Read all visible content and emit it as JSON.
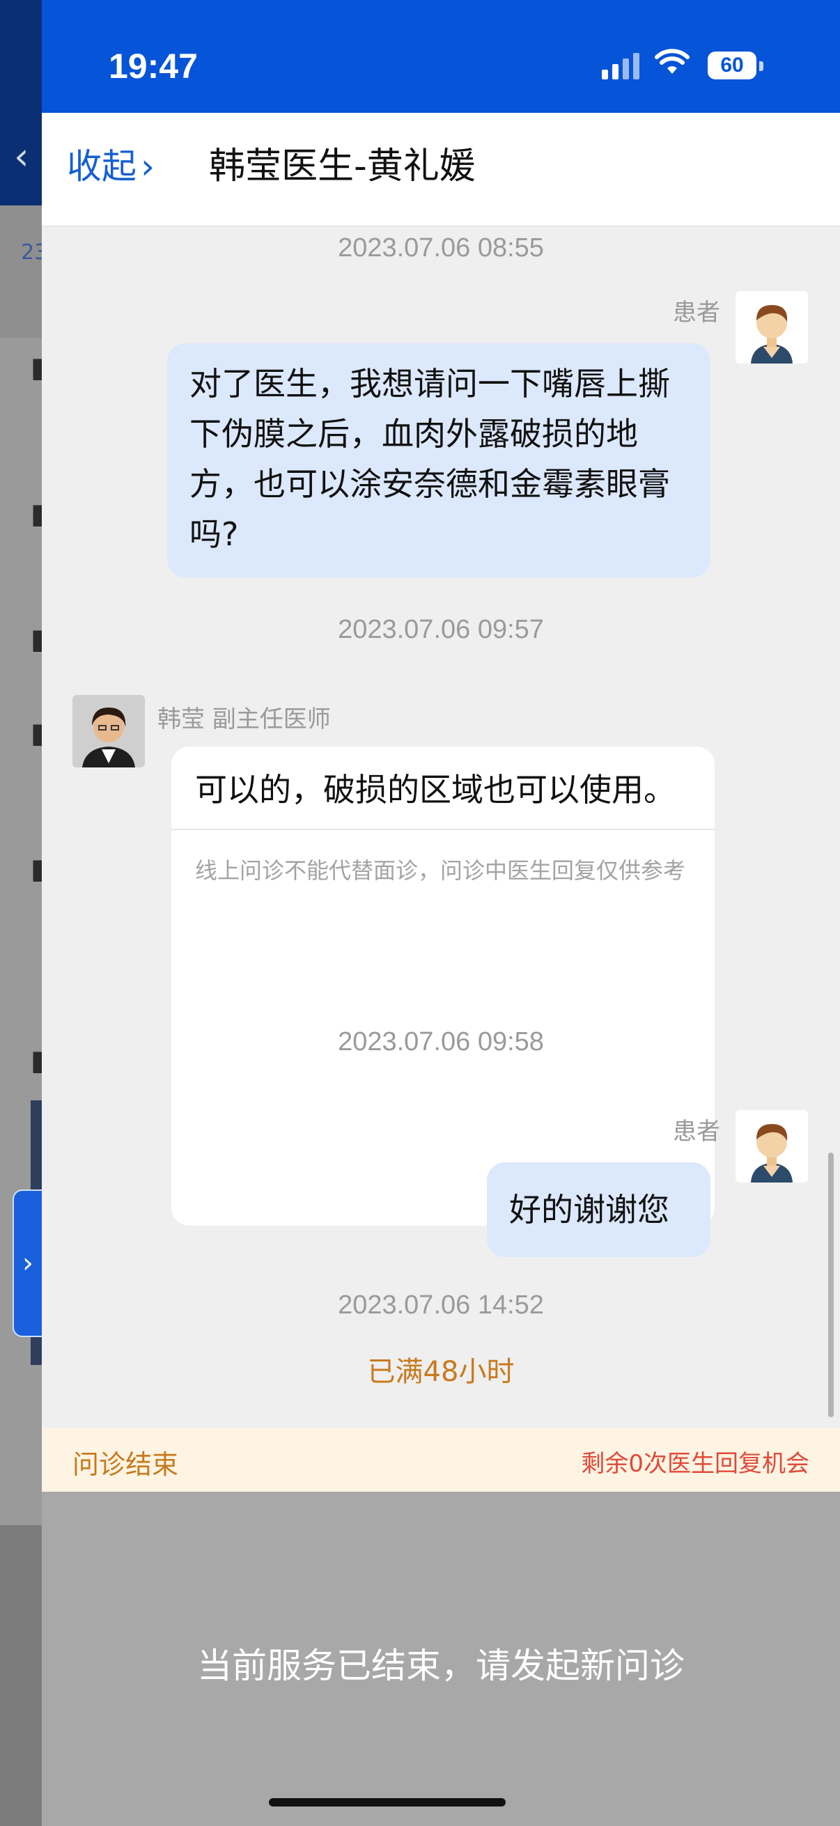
{
  "status_bar": {
    "time": "19:47",
    "battery": "60"
  },
  "nav": {
    "collapse_label": "收起",
    "title": "韩莹医生-黄礼媛"
  },
  "messages": [
    {
      "timestamp": "2023.07.06 08:55",
      "sender": "patient",
      "role": "患者",
      "text": "对了医生，我想请问一下嘴唇上撕下伪膜之后，血肉外露破损的地方，也可以涂安奈德和金霉素眼膏吗?"
    },
    {
      "timestamp": "2023.07.06 09:57",
      "sender": "doctor",
      "role": "韩莹 副主任医师",
      "text": "可以的，破损的区域也可以使用。",
      "disclaimer": "线上问诊不能代替面诊，问诊中医生回复仅供参考"
    },
    {
      "timestamp": "2023.07.06 09:58",
      "sender": "patient",
      "role": "患者",
      "text": "好的谢谢您"
    },
    {
      "timestamp": "2023.07.06 14:52",
      "notice": "已满48小时"
    }
  ],
  "consult_status": {
    "ended_label": "问诊结束",
    "remaining": "剩余0次医生回复机会"
  },
  "footer": {
    "message": "当前服务已结束，请发起新问诊"
  },
  "colors": {
    "brand_blue": "#0654d8",
    "patient_bubble": "#dce8fb",
    "warning_orange": "#c77a1e",
    "alert_red": "#e04a3a"
  }
}
